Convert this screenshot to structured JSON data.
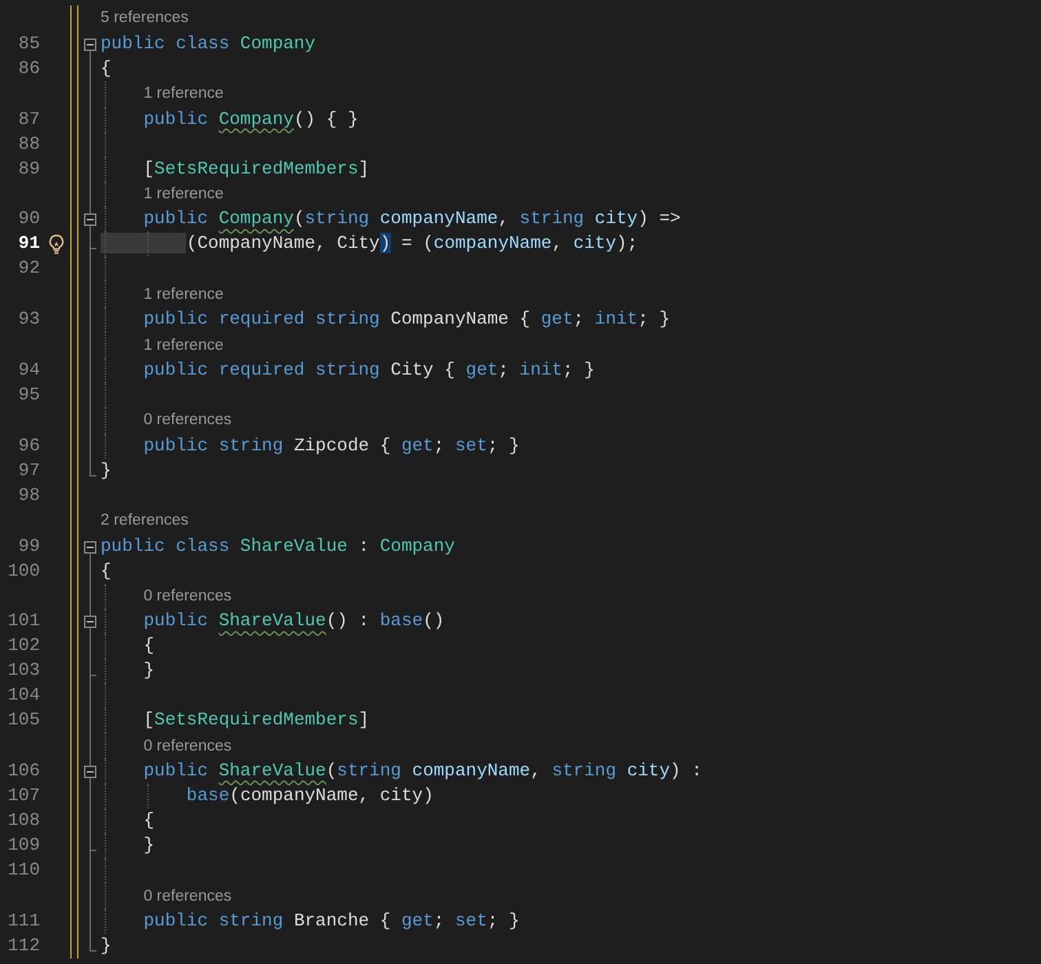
{
  "editor": {
    "lines": [
      {
        "number": "85",
        "lens": "5 references",
        "collapsible": true,
        "region_end": false,
        "lightbulb": false,
        "current": false,
        "tokens": [
          {
            "text": "public class ",
            "kind": "keyword"
          },
          {
            "text": "Company",
            "kind": "type"
          }
        ]
      },
      {
        "number": "86",
        "collapsible": false,
        "region_end": false,
        "lightbulb": false,
        "current": false,
        "tokens": [
          {
            "text": "{",
            "kind": "plain"
          }
        ]
      },
      {
        "number": "87",
        "lens": "1 reference",
        "collapsible": false,
        "region_end": false,
        "lightbulb": false,
        "current": false,
        "tokens": [
          {
            "text": "    public ",
            "kind": "keyword"
          },
          {
            "text": "Company",
            "kind": "ctor"
          },
          {
            "text": "() { }",
            "kind": "plain"
          }
        ]
      },
      {
        "number": "88",
        "collapsible": false,
        "region_end": false,
        "lightbulb": false,
        "current": false
      },
      {
        "number": "89",
        "collapsible": false,
        "region_end": false,
        "lightbulb": false,
        "current": false,
        "tokens": [
          {
            "text": "    [",
            "kind": "plain"
          },
          {
            "text": "SetsRequiredMembers",
            "kind": "type"
          },
          {
            "text": "]",
            "kind": "plain"
          }
        ]
      },
      {
        "number": "90",
        "lens": "1 reference",
        "collapsible": true,
        "region_end": false,
        "lightbulb": false,
        "current": false,
        "tokens": [
          {
            "text": "    public ",
            "kind": "keyword"
          },
          {
            "text": "Company",
            "kind": "ctor"
          },
          {
            "text": "(",
            "kind": "plain"
          },
          {
            "text": "string ",
            "kind": "keyword"
          },
          {
            "text": "companyName",
            "kind": "param"
          },
          {
            "text": ", ",
            "kind": "plain"
          },
          {
            "text": "string ",
            "kind": "keyword"
          },
          {
            "text": "city",
            "kind": "param"
          },
          {
            "text": ") =>",
            "kind": "plain"
          }
        ]
      },
      {
        "number": "91",
        "collapsible": false,
        "region_end": true,
        "lightbulb": true,
        "current": true,
        "tokens": [
          {
            "text": "        (CompanyName, City",
            "kind": "plain"
          },
          {
            "text": ")",
            "kind": "match"
          },
          {
            "text": " = (",
            "kind": "plain"
          },
          {
            "text": "companyName",
            "kind": "param"
          },
          {
            "text": ", ",
            "kind": "plain"
          },
          {
            "text": "city",
            "kind": "param"
          },
          {
            "text": ");",
            "kind": "plain"
          }
        ]
      },
      {
        "number": "92",
        "collapsible": false,
        "region_end": false,
        "lightbulb": false,
        "current": false
      },
      {
        "number": "93",
        "lens": "1 reference",
        "collapsible": false,
        "region_end": false,
        "lightbulb": false,
        "current": false,
        "tokens": [
          {
            "text": "    public required string ",
            "kind": "keyword"
          },
          {
            "text": "CompanyName { ",
            "kind": "plain"
          },
          {
            "text": "get",
            "kind": "keyword"
          },
          {
            "text": "; ",
            "kind": "plain"
          },
          {
            "text": "init",
            "kind": "keyword"
          },
          {
            "text": "; }",
            "kind": "plain"
          }
        ]
      },
      {
        "number": "94",
        "lens": "1 reference",
        "collapsible": false,
        "region_end": false,
        "lightbulb": false,
        "current": false,
        "tokens": [
          {
            "text": "    public required string ",
            "kind": "keyword"
          },
          {
            "text": "City { ",
            "kind": "plain"
          },
          {
            "text": "get",
            "kind": "keyword"
          },
          {
            "text": "; ",
            "kind": "plain"
          },
          {
            "text": "init",
            "kind": "keyword"
          },
          {
            "text": "; }",
            "kind": "plain"
          }
        ]
      },
      {
        "number": "95",
        "collapsible": false,
        "region_end": false,
        "lightbulb": false,
        "current": false
      },
      {
        "number": "96",
        "lens": "0 references",
        "collapsible": false,
        "region_end": false,
        "lightbulb": false,
        "current": false,
        "tokens": [
          {
            "text": "    public string ",
            "kind": "keyword"
          },
          {
            "text": "Zipcode { ",
            "kind": "plain"
          },
          {
            "text": "get",
            "kind": "keyword"
          },
          {
            "text": "; ",
            "kind": "plain"
          },
          {
            "text": "set",
            "kind": "keyword"
          },
          {
            "text": "; }",
            "kind": "plain"
          }
        ]
      },
      {
        "number": "97",
        "collapsible": false,
        "region_end": true,
        "lightbulb": false,
        "current": false,
        "tokens": [
          {
            "text": "}",
            "kind": "plain"
          }
        ]
      },
      {
        "number": "98",
        "collapsible": false,
        "region_end": false,
        "lightbulb": false,
        "current": false
      },
      {
        "number": "99",
        "lens": "2 references",
        "collapsible": true,
        "region_end": false,
        "lightbulb": false,
        "current": false,
        "tokens": [
          {
            "text": "public class ",
            "kind": "keyword"
          },
          {
            "text": "ShareValue",
            "kind": "type"
          },
          {
            "text": " : ",
            "kind": "plain"
          },
          {
            "text": "Company",
            "kind": "type"
          }
        ]
      },
      {
        "number": "100",
        "collapsible": false,
        "region_end": false,
        "lightbulb": false,
        "current": false,
        "tokens": [
          {
            "text": "{",
            "kind": "plain"
          }
        ]
      },
      {
        "number": "101",
        "lens": "0 references",
        "collapsible": true,
        "region_end": false,
        "lightbulb": false,
        "current": false,
        "tokens": [
          {
            "text": "    public ",
            "kind": "keyword"
          },
          {
            "text": "ShareValue",
            "kind": "ctor"
          },
          {
            "text": "() : ",
            "kind": "plain"
          },
          {
            "text": "base",
            "kind": "keyword"
          },
          {
            "text": "()",
            "kind": "plain"
          }
        ]
      },
      {
        "number": "102",
        "collapsible": false,
        "region_end": false,
        "lightbulb": false,
        "current": false,
        "tokens": [
          {
            "text": "    {",
            "kind": "plain"
          }
        ]
      },
      {
        "number": "103",
        "collapsible": false,
        "region_end": true,
        "lightbulb": false,
        "current": false,
        "tokens": [
          {
            "text": "    }",
            "kind": "plain"
          }
        ]
      },
      {
        "number": "104",
        "collapsible": false,
        "region_end": false,
        "lightbulb": false,
        "current": false
      },
      {
        "number": "105",
        "collapsible": false,
        "region_end": false,
        "lightbulb": false,
        "current": false,
        "tokens": [
          {
            "text": "    [",
            "kind": "plain"
          },
          {
            "text": "SetsRequiredMembers",
            "kind": "type"
          },
          {
            "text": "]",
            "kind": "plain"
          }
        ]
      },
      {
        "number": "106",
        "lens": "0 references",
        "collapsible": true,
        "region_end": false,
        "lightbulb": false,
        "current": false,
        "tokens": [
          {
            "text": "    public ",
            "kind": "keyword"
          },
          {
            "text": "ShareValue",
            "kind": "ctor"
          },
          {
            "text": "(",
            "kind": "plain"
          },
          {
            "text": "string ",
            "kind": "keyword"
          },
          {
            "text": "companyName",
            "kind": "param"
          },
          {
            "text": ", ",
            "kind": "plain"
          },
          {
            "text": "string ",
            "kind": "keyword"
          },
          {
            "text": "city",
            "kind": "param"
          },
          {
            "text": ") :",
            "kind": "plain"
          }
        ]
      },
      {
        "number": "107",
        "collapsible": false,
        "region_end": false,
        "lightbulb": false,
        "current": false,
        "tokens": [
          {
            "text": "        base",
            "kind": "keyword"
          },
          {
            "text": "(companyName, city)",
            "kind": "plain"
          }
        ]
      },
      {
        "number": "108",
        "collapsible": false,
        "region_end": false,
        "lightbulb": false,
        "current": false,
        "tokens": [
          {
            "text": "    {",
            "kind": "plain"
          }
        ]
      },
      {
        "number": "109",
        "collapsible": false,
        "region_end": true,
        "lightbulb": false,
        "current": false,
        "tokens": [
          {
            "text": "    }",
            "kind": "plain"
          }
        ]
      },
      {
        "number": "110",
        "collapsible": false,
        "region_end": false,
        "lightbulb": false,
        "current": false
      },
      {
        "number": "111",
        "lens": "0 references",
        "collapsible": false,
        "region_end": false,
        "lightbulb": false,
        "current": false,
        "tokens": [
          {
            "text": "    public string ",
            "kind": "keyword"
          },
          {
            "text": "Branche { ",
            "kind": "plain"
          },
          {
            "text": "get",
            "kind": "keyword"
          },
          {
            "text": "; ",
            "kind": "plain"
          },
          {
            "text": "set",
            "kind": "keyword"
          },
          {
            "text": "; }",
            "kind": "plain"
          }
        ]
      },
      {
        "number": "112",
        "collapsible": false,
        "region_end": true,
        "lightbulb": false,
        "current": false,
        "tokens": [
          {
            "text": "}",
            "kind": "plain"
          }
        ]
      }
    ]
  }
}
